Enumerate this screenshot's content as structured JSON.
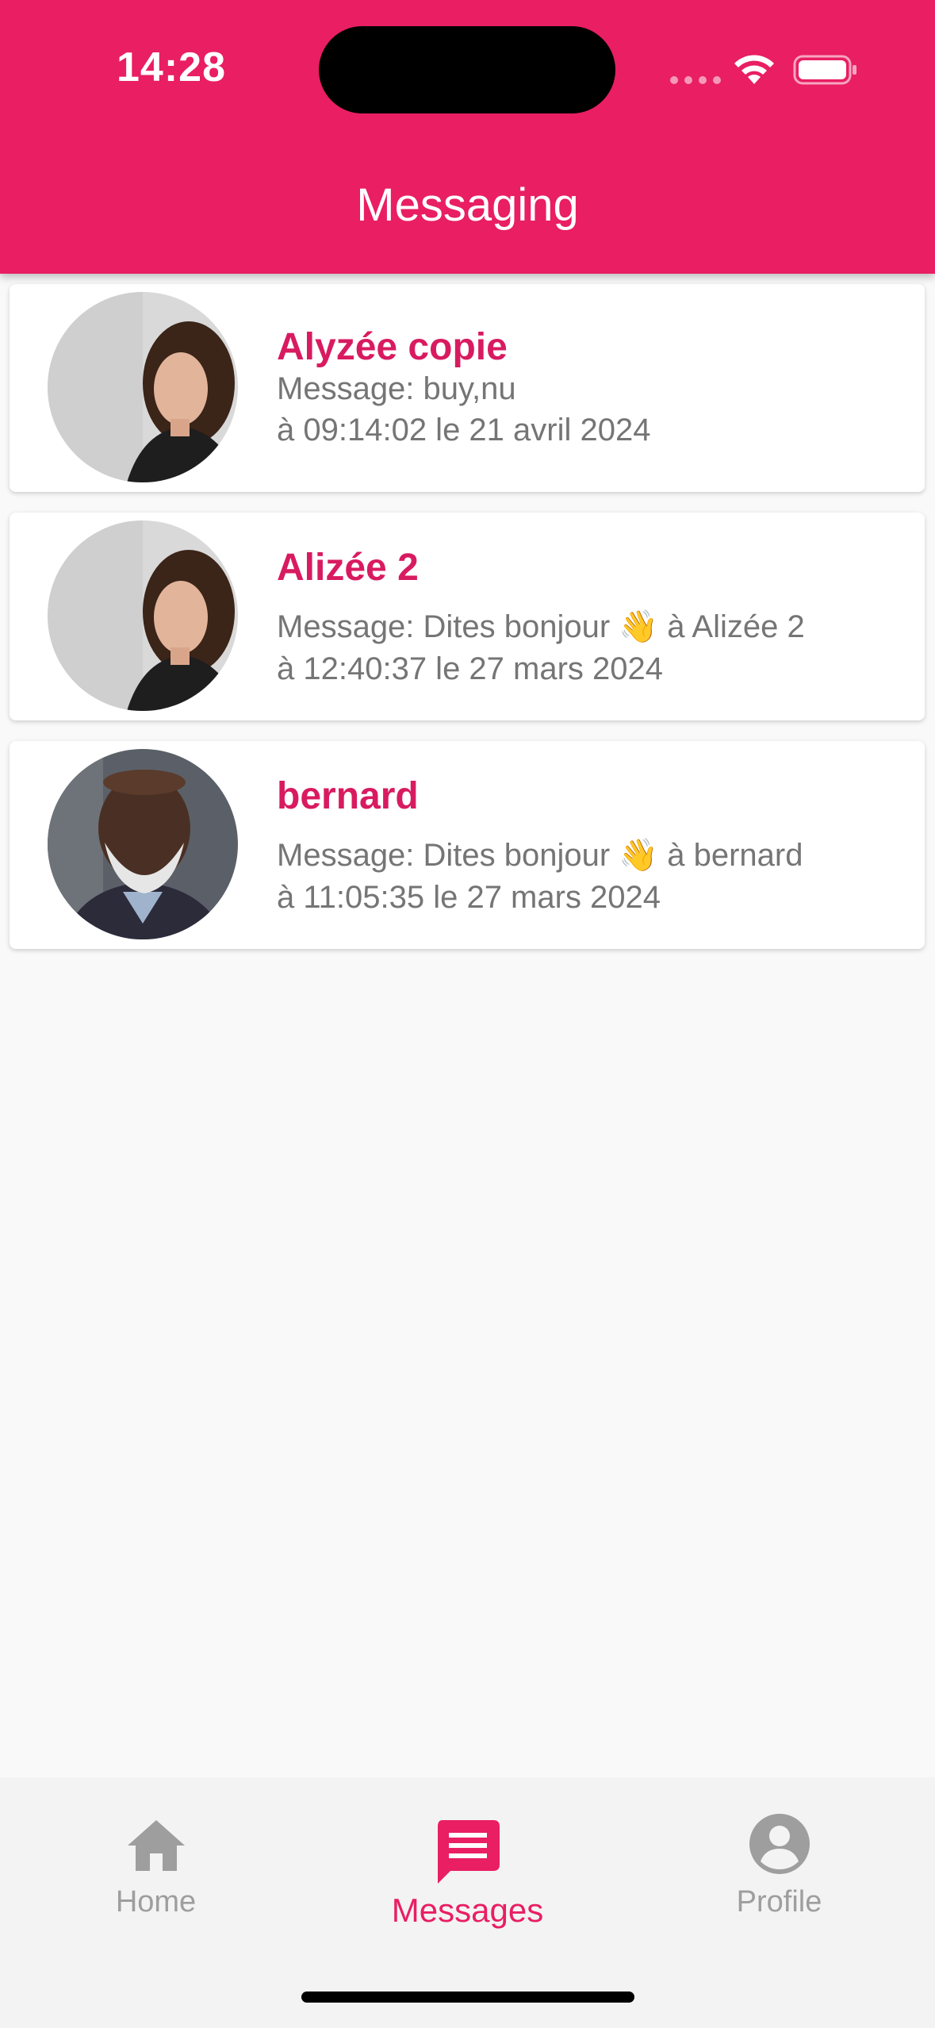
{
  "status_bar": {
    "time": "14:28"
  },
  "header": {
    "title": "Messaging",
    "color": "#e91e63"
  },
  "conversations": [
    {
      "name": "Alyzée copie",
      "message": "Message: buy,nu",
      "timestamp": "à 09:14:02 le 21 avril 2024",
      "avatar": "young-woman-avatar"
    },
    {
      "name": "Alizée 2",
      "message": "Message: Dites bonjour 👋  à Alizée 2",
      "timestamp": "à 12:40:37 le 27 mars 2024",
      "avatar": "young-woman-avatar"
    },
    {
      "name": "bernard",
      "message": "Message: Dites bonjour 👋  à bernard",
      "timestamp": "à 11:05:35 le 27 mars 2024",
      "avatar": "older-man-avatar"
    }
  ],
  "bottom_nav": {
    "items": [
      {
        "label": "Home",
        "icon": "home-icon",
        "active": false
      },
      {
        "label": "Messages",
        "icon": "chat-icon",
        "active": true
      },
      {
        "label": "Profile",
        "icon": "account-circle-icon",
        "active": false
      }
    ],
    "active_color": "#e91e63",
    "inactive_color": "#9e9e9e"
  }
}
